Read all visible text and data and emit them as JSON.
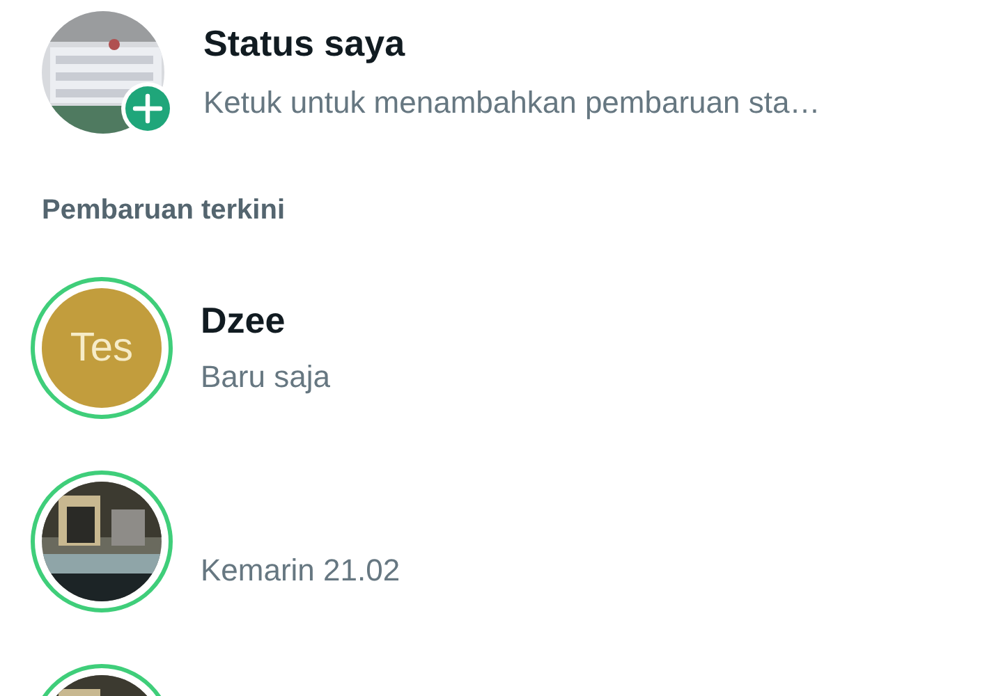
{
  "my_status": {
    "title": "Status saya",
    "subtitle": "Ketuk untuk menambahkan pembaruan sta…"
  },
  "section_header": "Pembaruan terkini",
  "updates": [
    {
      "name": "Dzee",
      "time": "Baru saja",
      "seen": false,
      "avatar": {
        "kind": "initials",
        "text": "Tes",
        "color": "#c29d3d"
      }
    },
    {
      "time": "Kemarin 21.02",
      "seen": false
    },
    {
      "seen": false
    }
  ]
}
